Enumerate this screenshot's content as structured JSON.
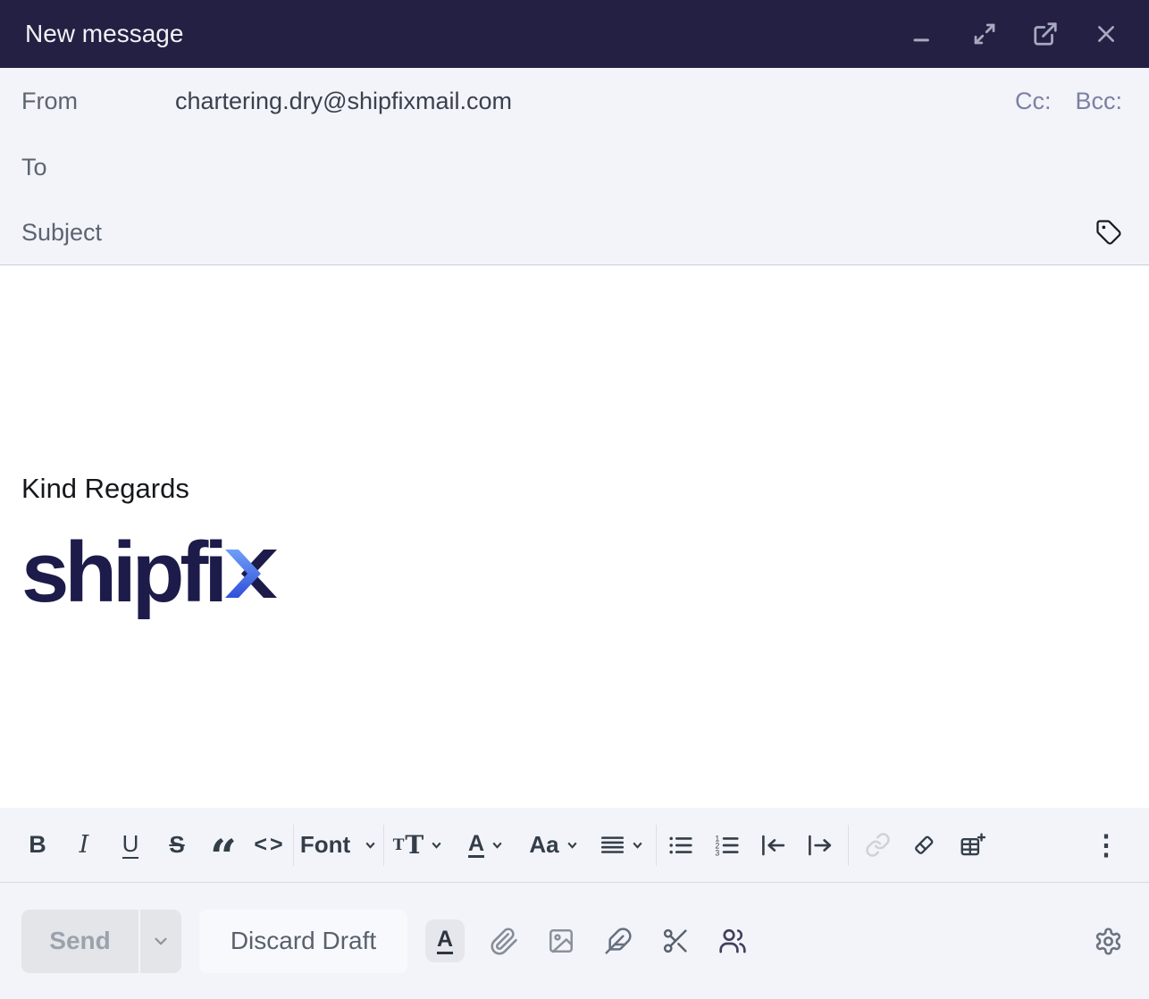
{
  "window": {
    "title": "New message"
  },
  "compose": {
    "from_label": "From",
    "from_value": "chartering.dry@shipfixmail.com",
    "cc_label": "Cc:",
    "bcc_label": "Bcc:",
    "to_label": "To",
    "to_value": "",
    "subject_label": "Subject",
    "subject_value": ""
  },
  "body": {
    "closing": "Kind Regards",
    "logo_text": "shipfi",
    "logo_x": "x"
  },
  "toolbar": {
    "bold": "B",
    "italic": "I",
    "underline": "U",
    "strikethrough": "S",
    "quote_glyph": "“",
    "code_glyph": "<>",
    "font_label": "Font",
    "size_small": "T",
    "size_large": "T",
    "color_glyph": "A",
    "case_glyph": "Aa",
    "list_numbers": [
      "1",
      "2",
      "3"
    ],
    "more_glyph": "⋮"
  },
  "footer": {
    "send_label": "Send",
    "discard_label": "Discard Draft",
    "format_glyph": "A"
  },
  "icons": {
    "titlebar": [
      "minimize-icon",
      "expand-icon",
      "popout-icon",
      "close-icon"
    ],
    "subject": [
      "tag-icon"
    ],
    "toolbar": [
      "chevron-down-icon",
      "align-icon",
      "bullet-list-icon",
      "numbered-list-icon",
      "outdent-icon",
      "indent-icon",
      "link-icon",
      "eraser-icon",
      "insert-table-icon",
      "more-options-icon"
    ],
    "footer": [
      "attachment-icon",
      "image-icon",
      "feather-icon",
      "scissors-icon",
      "contacts-icon",
      "settings-gear-icon"
    ]
  },
  "colors": {
    "titlebar_bg": "#232043",
    "panel_bg": "#f3f4f9",
    "body_bg": "#ffffff",
    "logo_navy": "#1d1b4a",
    "logo_blue_top": "#6f9ef9",
    "logo_blue_bottom": "#3050d8",
    "divider": "#c9cdd8",
    "disabled_text": "#9aa2ac"
  }
}
